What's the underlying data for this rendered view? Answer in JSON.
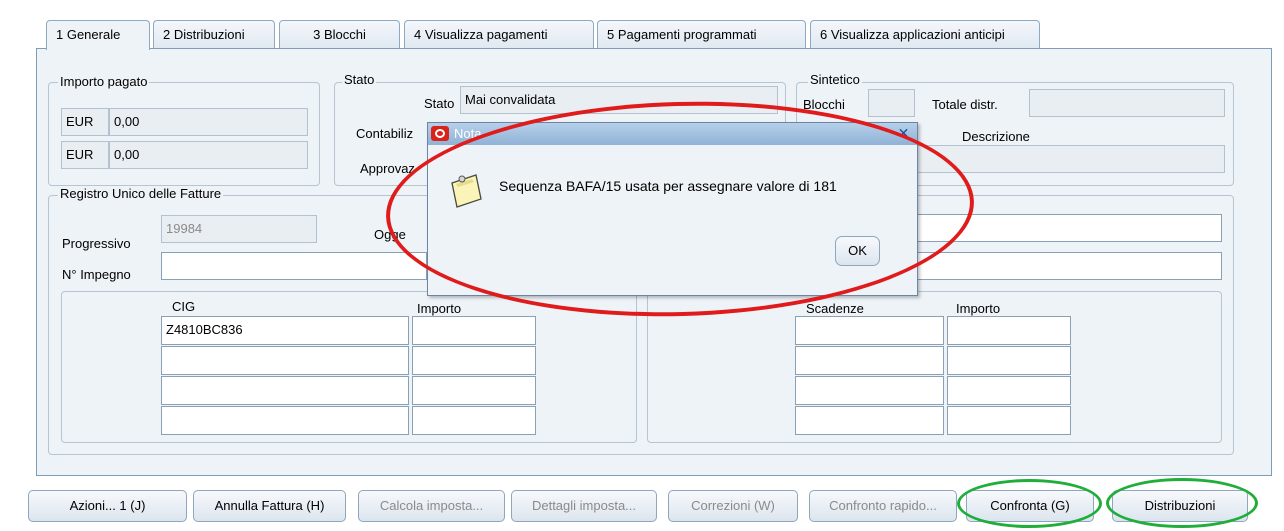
{
  "tabs": [
    {
      "label": "1 Generale"
    },
    {
      "label": "2 Distribuzioni"
    },
    {
      "label": "3 Blocchi"
    },
    {
      "label": "4 Visualizza pagamenti"
    },
    {
      "label": "5 Pagamenti programmati"
    },
    {
      "label": "6 Visualizza applicazioni anticipi"
    }
  ],
  "importo_pagato": {
    "title": "Importo pagato",
    "rows": [
      {
        "currency": "EUR",
        "value": "0,00"
      },
      {
        "currency": "EUR",
        "value": "0,00"
      }
    ]
  },
  "stato": {
    "title": "Stato",
    "stato_label": "Stato",
    "stato_value": "Mai convalidata",
    "contabilizzato_label": "Contabiliz",
    "approvazione_label": "Approvaz"
  },
  "sintetico": {
    "title": "Sintetico",
    "blocchi_label": "Blocchi",
    "totale_distr_label": "Totale distr.",
    "descrizione_label": "Descrizione"
  },
  "registro": {
    "title": "Registro Unico delle Fatture",
    "progressivo_label": "Progressivo",
    "progressivo_value": "19984",
    "oggetto_label": "Ogge",
    "impegno_label": "N° Impegno"
  },
  "cig_table": {
    "col_cig": "CIG",
    "col_importo": "Importo",
    "rows": [
      {
        "cig": "Z4810BC836",
        "importo": ""
      },
      {
        "cig": "",
        "importo": ""
      },
      {
        "cig": "",
        "importo": ""
      },
      {
        "cig": "",
        "importo": ""
      }
    ]
  },
  "scad_table": {
    "col_scadenze": "Scadenze",
    "col_importo": "Importo"
  },
  "dialog": {
    "title": "Nota",
    "message": "Sequenza BAFA/15 usata per assegnare valore di 181",
    "ok": "OK"
  },
  "buttons": {
    "azioni": "Azioni... 1 (J)",
    "annulla": "Annulla Fattura (H)",
    "calcola": "Calcola imposta...",
    "dettagli": "Dettagli imposta...",
    "correzioni": "Correzioni (W)",
    "confronto_rapido": "Confronto rapido...",
    "confronta": "Confronta (G)",
    "distribuzioni": "Distribuzioni"
  },
  "annotations": {
    "red": "#e01b1b",
    "green": "#1fae3a"
  }
}
